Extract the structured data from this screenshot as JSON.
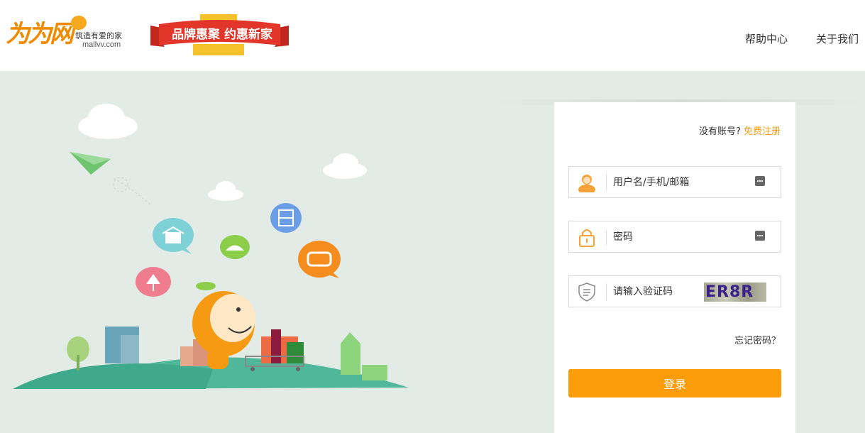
{
  "header": {
    "logo": {
      "mark": "为为网",
      "slogan": "筑造有爱的家",
      "domain": "mallvv.com"
    },
    "banner_text": "品牌惠聚 约惠新家",
    "nav": [
      "帮助中心",
      "关于我们"
    ]
  },
  "login": {
    "register_prompt": "没有账号?",
    "register_link": "免费注册",
    "username_placeholder": "用户名/手机/邮箱",
    "password_placeholder": "密码",
    "captcha_placeholder": "请输入验证码",
    "captcha_text": "ER8R",
    "forgot_label": "忘记密码？",
    "submit_label": "登录"
  },
  "colors": {
    "accent": "#fb9c0b",
    "link": "#f39c1a",
    "page_bg": "#e3ebe7"
  }
}
